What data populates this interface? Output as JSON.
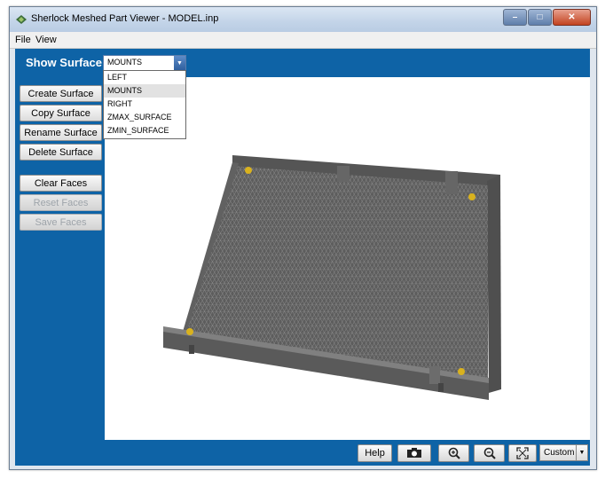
{
  "window": {
    "title": "Sherlock Meshed Part Viewer - MODEL.inp",
    "buttons": {
      "minimize": "–",
      "maximize": "□",
      "close": "✕"
    }
  },
  "menu": {
    "file": "File",
    "view": "View"
  },
  "surface": {
    "label": "Show Surface:",
    "selected": "MOUNTS",
    "options": [
      "LEFT",
      "MOUNTS",
      "RIGHT",
      "ZMAX_SURFACE",
      "ZMIN_SURFACE"
    ]
  },
  "sidebar": {
    "create": "Create Surface",
    "copy": "Copy Surface",
    "rename": "Rename Surface",
    "delete": "Delete Surface",
    "clear_faces": "Clear Faces",
    "reset_faces": "Reset Faces",
    "save_faces": "Save Faces"
  },
  "toolbar": {
    "help": "Help",
    "view_mode": "Custom",
    "icons": [
      "camera-icon",
      "zoom-in-icon",
      "zoom-out-icon",
      "fit-view-icon"
    ]
  },
  "colors": {
    "panel_blue": "#0e63a6",
    "mesh_gray": "#5a5a5a",
    "mount_yellow": "#d9b21e"
  }
}
